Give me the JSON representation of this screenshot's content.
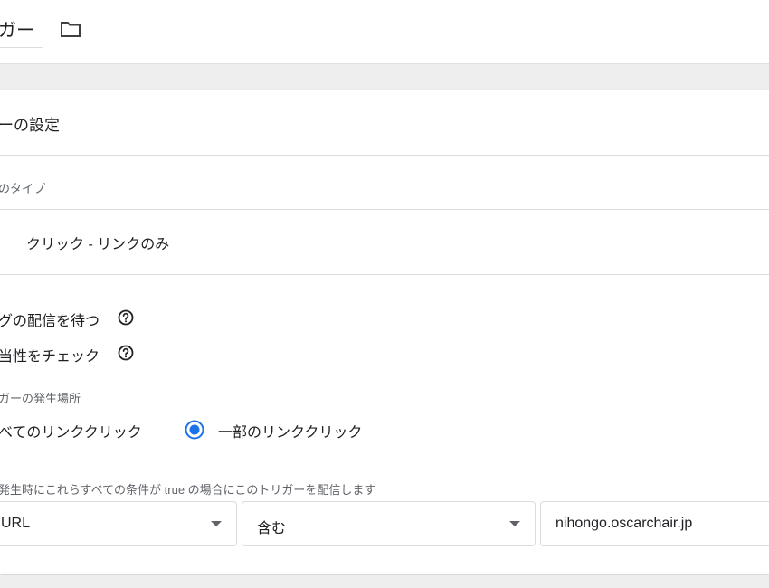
{
  "header": {
    "title": "ガー",
    "folder_icon": "folder-icon"
  },
  "trigger_config": {
    "section_title": "ーの設定",
    "type_label": "のタイプ",
    "type_value": "クリック - リンクのみ",
    "wait_for_tags": "グの配信を待つ",
    "check_validation": "当性をチェック",
    "fire_on_label": "ガーの発生場所",
    "radio_all": "べてのリンククリック",
    "radio_some": "一部のリンククリック",
    "selected_radio": "radio_some",
    "condition_label": "発生時にこれらすべての条件が true の場合にこのトリガーを配信します",
    "condition": {
      "variable": "URL",
      "operator": "含む",
      "value": "nihongo.oscarchair.jp"
    }
  },
  "colors": {
    "accent": "#1a73e8",
    "text": "#202124",
    "secondary_text": "#5f6368",
    "divider": "#dadce0",
    "band": "#eeeeee"
  }
}
